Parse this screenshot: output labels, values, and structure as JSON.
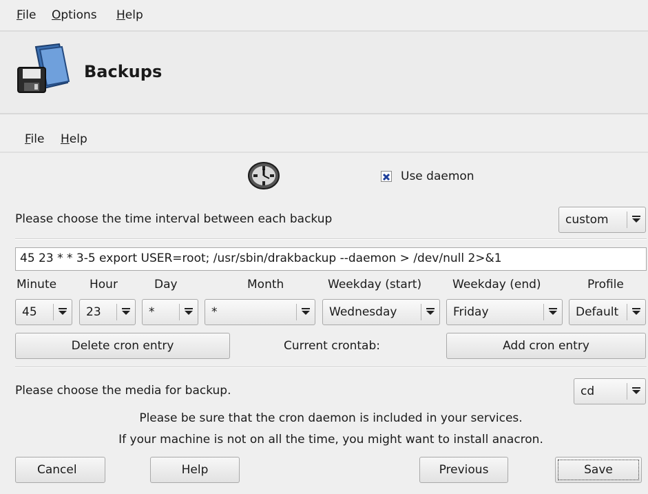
{
  "menubar": {
    "file": "File",
    "options": "Options",
    "help": "Help"
  },
  "banner": {
    "title": "Backups",
    "icon": "folder-floppy-icon"
  },
  "submenu": {
    "file": "File",
    "help": "Help"
  },
  "daemon": {
    "icon": "clock-icon",
    "checkbox_label": "Use daemon",
    "checked": true
  },
  "interval": {
    "label": "Please choose the time interval between each backup",
    "value": "custom"
  },
  "cron_line": "45 23 * * 3-5 export USER=root; /usr/sbin/drakbackup  --daemon > /dev/null 2>&1",
  "columns": {
    "minute": "Minute",
    "hour": "Hour",
    "day": "Day",
    "month": "Month",
    "weekday_start": "Weekday (start)",
    "weekday_end": "Weekday (end)",
    "profile": "Profile"
  },
  "values": {
    "minute": "45",
    "hour": "23",
    "day": "*",
    "month": "*",
    "weekday_start": "Wednesday",
    "weekday_end": "Friday",
    "profile": "Default"
  },
  "cron_buttons": {
    "delete": "Delete cron entry",
    "current": "Current crontab:",
    "add": "Add cron entry"
  },
  "media": {
    "label": "Please choose the media for backup.",
    "value": "cd"
  },
  "notes": {
    "line1": "Please be sure that the cron daemon is included in your services.",
    "line2": "If your machine is not on all the time, you might want to install anacron."
  },
  "footer": {
    "cancel": "Cancel",
    "help": "Help",
    "previous": "Previous",
    "save": "Save"
  }
}
